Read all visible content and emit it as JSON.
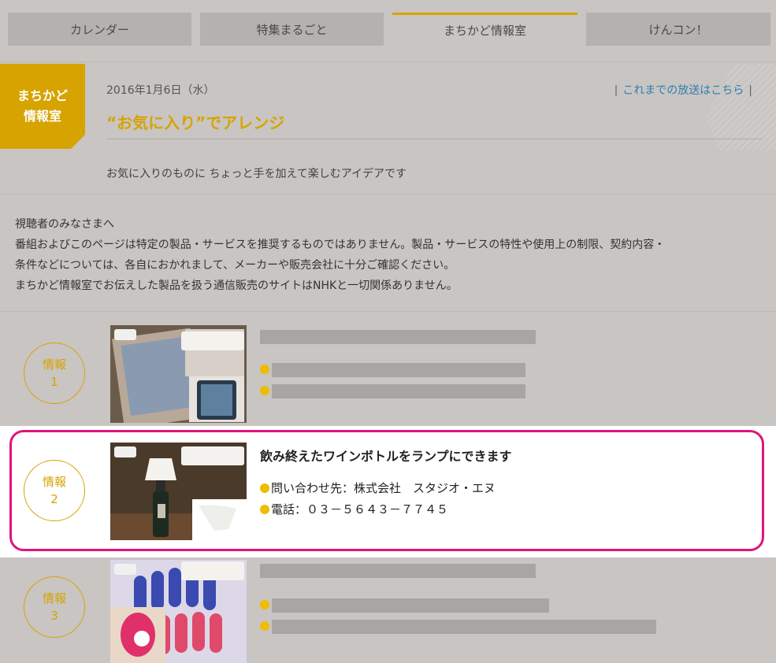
{
  "tabs": [
    {
      "label": "カレンダー",
      "active": false
    },
    {
      "label": "特集まるごと",
      "active": false
    },
    {
      "label": "まちかど情報室",
      "active": true
    },
    {
      "label": "けんコン！",
      "active": false
    }
  ],
  "badge": {
    "line1": "まちかど",
    "line2": "情報室"
  },
  "header": {
    "date": "2016年1月6日（水）",
    "archive_link": "これまでの放送はこちら",
    "title": "“お気に入り”でアレンジ",
    "description": "お気に入りのものに ちょっと手を加えて楽しむアイデアです"
  },
  "notice": {
    "line1": "視聴者のみなさまへ",
    "line2": "番組およびこのページは特定の製品・サービスを推奨するものではありません。製品・サービスの特性や使用上の制限、契約内容・",
    "line3": "条件などについては、各自におかれまして、メーカーや販売会社に十分ご確認ください。",
    "line4": "まちかど情報室でお伝えした製品を扱う通信販売のサイトはNHKと一切関係ありません。"
  },
  "items": [
    {
      "label1": "情報",
      "label2": "1"
    },
    {
      "label1": "情報",
      "label2": "2",
      "title": "飲み終えたワインボトルをランプにできます",
      "contact": "問い合わせ先：株式会社　スタジオ・エヌ",
      "phone": "電話：０３－５６４３－７７４５"
    },
    {
      "label1": "情報",
      "label2": "3"
    }
  ],
  "colors": {
    "accent": "#d6a300",
    "highlight": "#e0147a",
    "link": "#2e7fb0"
  }
}
